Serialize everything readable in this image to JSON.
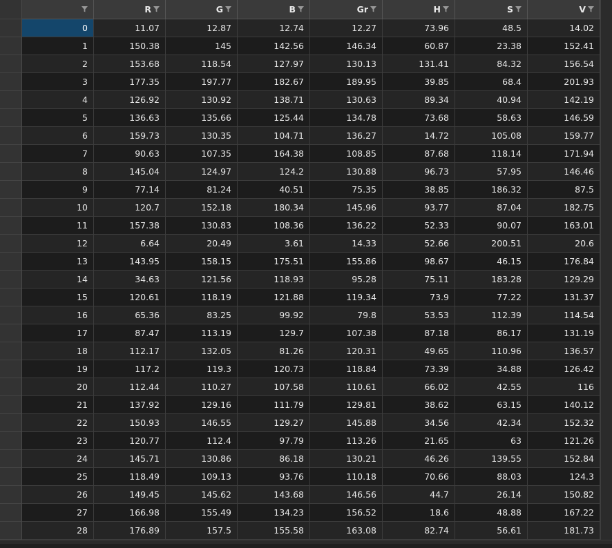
{
  "columns": [
    "",
    "R",
    "G",
    "B",
    "Gr",
    "H",
    "S",
    "V"
  ],
  "rows": [
    [
      "0",
      "11.07",
      "12.87",
      "12.74",
      "12.27",
      "73.96",
      "48.5",
      "14.02"
    ],
    [
      "1",
      "150.38",
      "145",
      "142.56",
      "146.34",
      "60.87",
      "23.38",
      "152.41"
    ],
    [
      "2",
      "153.68",
      "118.54",
      "127.97",
      "130.13",
      "131.41",
      "84.32",
      "156.54"
    ],
    [
      "3",
      "177.35",
      "197.77",
      "182.67",
      "189.95",
      "39.85",
      "68.4",
      "201.93"
    ],
    [
      "4",
      "126.92",
      "130.92",
      "138.71",
      "130.63",
      "89.34",
      "40.94",
      "142.19"
    ],
    [
      "5",
      "136.63",
      "135.66",
      "125.44",
      "134.78",
      "73.68",
      "58.63",
      "146.59"
    ],
    [
      "6",
      "159.73",
      "130.35",
      "104.71",
      "136.27",
      "14.72",
      "105.08",
      "159.77"
    ],
    [
      "7",
      "90.63",
      "107.35",
      "164.38",
      "108.85",
      "87.68",
      "118.14",
      "171.94"
    ],
    [
      "8",
      "145.04",
      "124.97",
      "124.2",
      "130.88",
      "96.73",
      "57.95",
      "146.46"
    ],
    [
      "9",
      "77.14",
      "81.24",
      "40.51",
      "75.35",
      "38.85",
      "186.32",
      "87.5"
    ],
    [
      "10",
      "120.7",
      "152.18",
      "180.34",
      "145.96",
      "93.77",
      "87.04",
      "182.75"
    ],
    [
      "11",
      "157.38",
      "130.83",
      "108.36",
      "136.22",
      "52.33",
      "90.07",
      "163.01"
    ],
    [
      "12",
      "6.64",
      "20.49",
      "3.61",
      "14.33",
      "52.66",
      "200.51",
      "20.6"
    ],
    [
      "13",
      "143.95",
      "158.15",
      "175.51",
      "155.86",
      "98.67",
      "46.15",
      "176.84"
    ],
    [
      "14",
      "34.63",
      "121.56",
      "118.93",
      "95.28",
      "75.11",
      "183.28",
      "129.29"
    ],
    [
      "15",
      "120.61",
      "118.19",
      "121.88",
      "119.34",
      "73.9",
      "77.22",
      "131.37"
    ],
    [
      "16",
      "65.36",
      "83.25",
      "99.92",
      "79.8",
      "53.53",
      "112.39",
      "114.54"
    ],
    [
      "17",
      "87.47",
      "113.19",
      "129.7",
      "107.38",
      "87.18",
      "86.17",
      "131.19"
    ],
    [
      "18",
      "112.17",
      "132.05",
      "81.26",
      "120.31",
      "49.65",
      "110.96",
      "136.57"
    ],
    [
      "19",
      "117.2",
      "119.3",
      "120.73",
      "118.84",
      "73.39",
      "34.88",
      "126.42"
    ],
    [
      "20",
      "112.44",
      "110.27",
      "107.58",
      "110.61",
      "66.02",
      "42.55",
      "116"
    ],
    [
      "21",
      "137.92",
      "129.16",
      "111.79",
      "129.81",
      "38.62",
      "63.15",
      "140.12"
    ],
    [
      "22",
      "150.93",
      "146.55",
      "129.27",
      "145.88",
      "34.56",
      "42.34",
      "152.32"
    ],
    [
      "23",
      "120.77",
      "112.4",
      "97.79",
      "113.26",
      "21.65",
      "63",
      "121.26"
    ],
    [
      "24",
      "145.71",
      "130.86",
      "86.18",
      "130.21",
      "46.26",
      "139.55",
      "152.84"
    ],
    [
      "25",
      "118.49",
      "109.13",
      "93.76",
      "110.18",
      "70.66",
      "88.03",
      "124.3"
    ],
    [
      "26",
      "149.45",
      "145.62",
      "143.68",
      "146.56",
      "44.7",
      "26.14",
      "150.82"
    ],
    [
      "27",
      "166.98",
      "155.49",
      "134.23",
      "156.52",
      "18.6",
      "48.88",
      "167.22"
    ],
    [
      "28",
      "176.89",
      "157.5",
      "155.58",
      "163.08",
      "82.74",
      "56.61",
      "181.73"
    ]
  ],
  "selected_row": 0,
  "colors": {
    "background": "#1f1f1f",
    "header": "#3a3a3a",
    "selected": "#14466b"
  },
  "icons": {
    "header_filter": "filter-icon"
  }
}
